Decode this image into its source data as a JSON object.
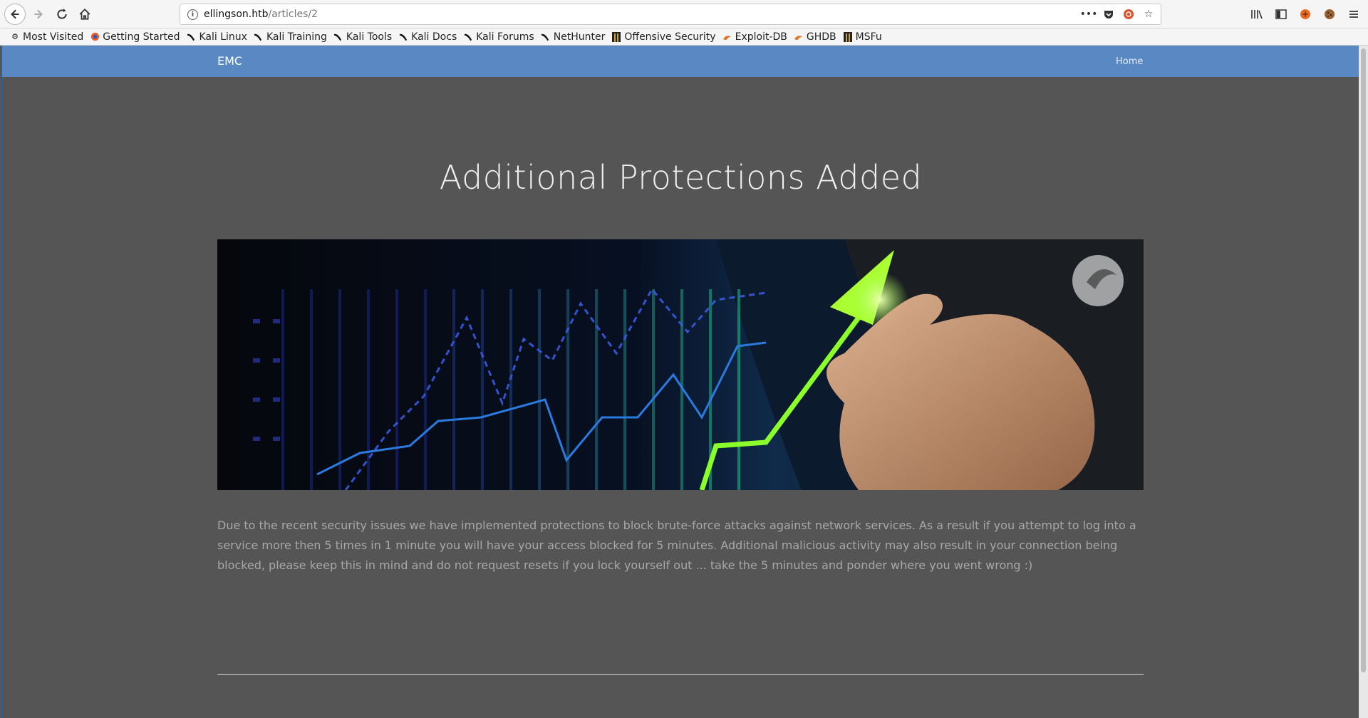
{
  "browser": {
    "url_host": "ellingson.htb",
    "url_path": "/articles/2",
    "url_actions": [
      "more-icon",
      "pocket-icon",
      "ublock-icon",
      "bookmark-star-icon"
    ],
    "right_tools": [
      "library-icon",
      "sidebar-icon",
      "extension-icon",
      "cookie-icon",
      "menu-icon"
    ]
  },
  "bookmarks": [
    {
      "label": "Most Visited",
      "icon": "gear-icon"
    },
    {
      "label": "Getting Started",
      "icon": "firefox-icon"
    },
    {
      "label": "Kali Linux",
      "icon": "kali-dragon-icon"
    },
    {
      "label": "Kali Training",
      "icon": "kali-dragon-icon"
    },
    {
      "label": "Kali Tools",
      "icon": "kali-dragon-icon"
    },
    {
      "label": "Kali Docs",
      "icon": "kali-dragon-icon"
    },
    {
      "label": "Kali Forums",
      "icon": "kali-dragon-icon"
    },
    {
      "label": "NetHunter",
      "icon": "kali-dragon-icon"
    },
    {
      "label": "Offensive Security",
      "icon": "offsec-icon"
    },
    {
      "label": "Exploit-DB",
      "icon": "exploitdb-icon"
    },
    {
      "label": "GHDB",
      "icon": "exploitdb-icon"
    },
    {
      "label": "MSFu",
      "icon": "offsec-icon"
    }
  ],
  "site": {
    "brand": "EMC",
    "nav_home": "Home"
  },
  "article": {
    "title": "Additional Protections Added",
    "body": "Due to the recent security issues we have implemented protections to block brute-force attacks against network services. As a result if you attempt to log into a service more then 5 times in 1 minute you will have your access blocked for 5 minutes. Additional malicious activity may also result in your connection being blocked, please keep this in mind and do not request resets if you lock yourself out ... take the 5 minutes and ponder where you went wrong :)",
    "hero_image": "business-growth-chart-hand-image"
  },
  "colors": {
    "navbar": "#5a88c2",
    "page_bg": "#555555",
    "body_text": "#a8a8a8"
  }
}
